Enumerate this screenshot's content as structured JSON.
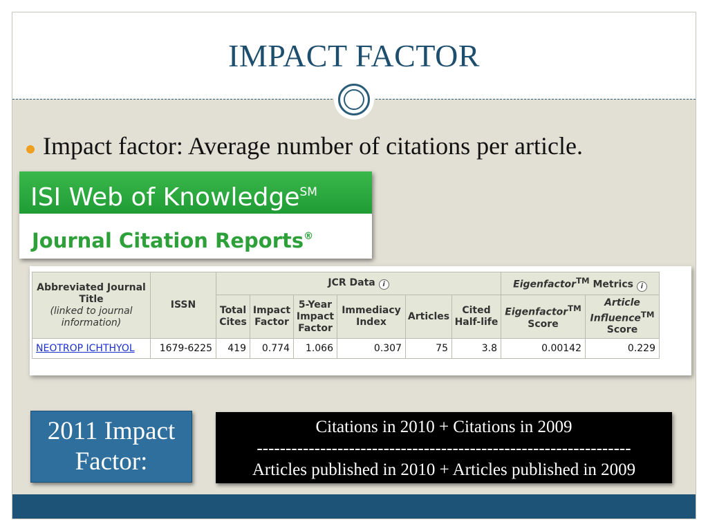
{
  "slide": {
    "title": "IMPACT FACTOR",
    "bullet": "Impact factor: Average number of citations per article."
  },
  "logo": {
    "line1": "ISI Web of Knowledge",
    "line1_mark": "SM",
    "line2": "Journal Citation Reports",
    "line2_mark": "®"
  },
  "jcr_table": {
    "header": {
      "abbrev_title": "Abbreviated Journal Title",
      "abbrev_note": "(linked to journal information)",
      "issn": "ISSN",
      "jcr_data": "JCR Data",
      "eigen_group": "Eigenfactor",
      "eigen_group_tm": "TM",
      "eigen_group_suffix": "Metrics",
      "total_cites": "Total Cites",
      "impact_factor": "Impact Factor",
      "five_year": "5-Year Impact Factor",
      "immediacy": "Immediacy Index",
      "articles": "Articles",
      "cited_half_life": "Cited Half-life",
      "eigen_score_a": "Eigenfactor",
      "eigen_score_tm": "TM",
      "eigen_score_b": "Score",
      "article_influence_a": "Article Influence",
      "article_influence_tm": "TM",
      "article_influence_b": "Score",
      "info_icon": "info-icon"
    },
    "row": {
      "journal": "NEOTROP ICHTHYOL",
      "issn": "1679-6225",
      "total_cites": "419",
      "impact_factor": "0.774",
      "five_year": "1.066",
      "immediacy": "0.307",
      "articles": "75",
      "cited_half_life": "3.8",
      "eigenfactor": "0.00142",
      "article_influence": "0.229"
    }
  },
  "impact_label": {
    "line1": "2011 Impact",
    "line2": "Factor:"
  },
  "formula": {
    "numerator": "Citations in 2010 + Citations in 2009",
    "divider": "-----------------------------------------------------------------",
    "denominator": "Articles  published in 2010 + Articles published in 2009"
  },
  "colors": {
    "title": "#1e4e6e",
    "footer": "#1c5376",
    "background": "#e2dfd4",
    "bullet": "#f0a020",
    "logo_green": "#2ea03a",
    "label_box": "#2e6f9e"
  }
}
